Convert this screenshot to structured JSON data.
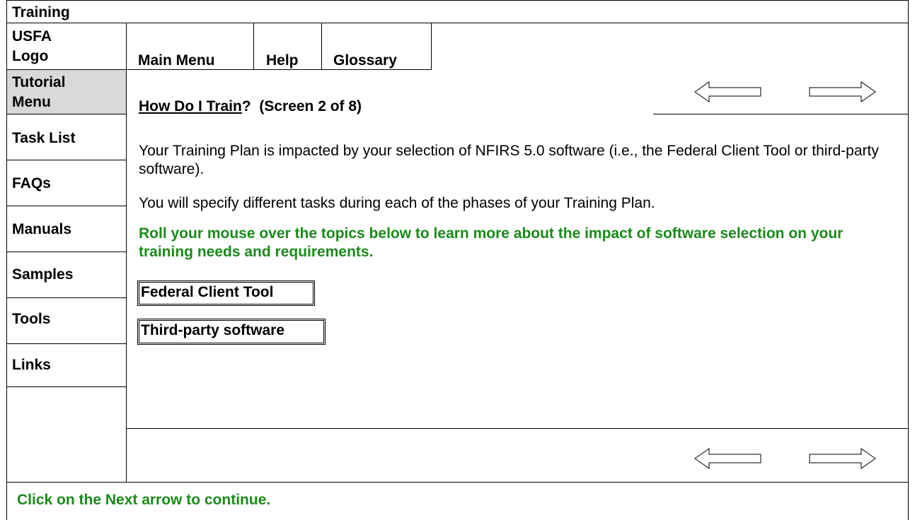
{
  "header": {
    "title": "Training",
    "logo_label": "USFA Logo",
    "logo_line1": "USFA",
    "logo_line2": "Logo"
  },
  "top_nav": {
    "main_menu": "Main Menu",
    "help": "Help",
    "glossary": "Glossary"
  },
  "sidebar": {
    "tutorial_menu_line1": "Tutorial",
    "tutorial_menu_line2": "Menu",
    "items": [
      {
        "label": "Task List"
      },
      {
        "label": "FAQs"
      },
      {
        "label": "Manuals"
      },
      {
        "label": "Samples"
      },
      {
        "label": "Tools"
      },
      {
        "label": "Links"
      }
    ]
  },
  "content": {
    "title_link": "How Do I Train",
    "title_rest": "?  (Screen 2 of 8)",
    "paragraph1": "Your Training Plan is impacted by your selection of NFIRS 5.0 software (i.e., the Federal Client Tool or third-party software).",
    "paragraph2": "You will specify different tasks during each of the phases of your Training Plan.",
    "instruction": "Roll your mouse over the topics below to learn more about the impact of software selection on your training needs and requirements.",
    "topics": [
      {
        "label": "Federal Client Tool"
      },
      {
        "label": "Third-party software"
      }
    ]
  },
  "navigation": {
    "back_icon": "left-arrow-icon",
    "next_icon": "right-arrow-icon"
  },
  "footer": {
    "instruction": "Click on the Next arrow to continue."
  }
}
